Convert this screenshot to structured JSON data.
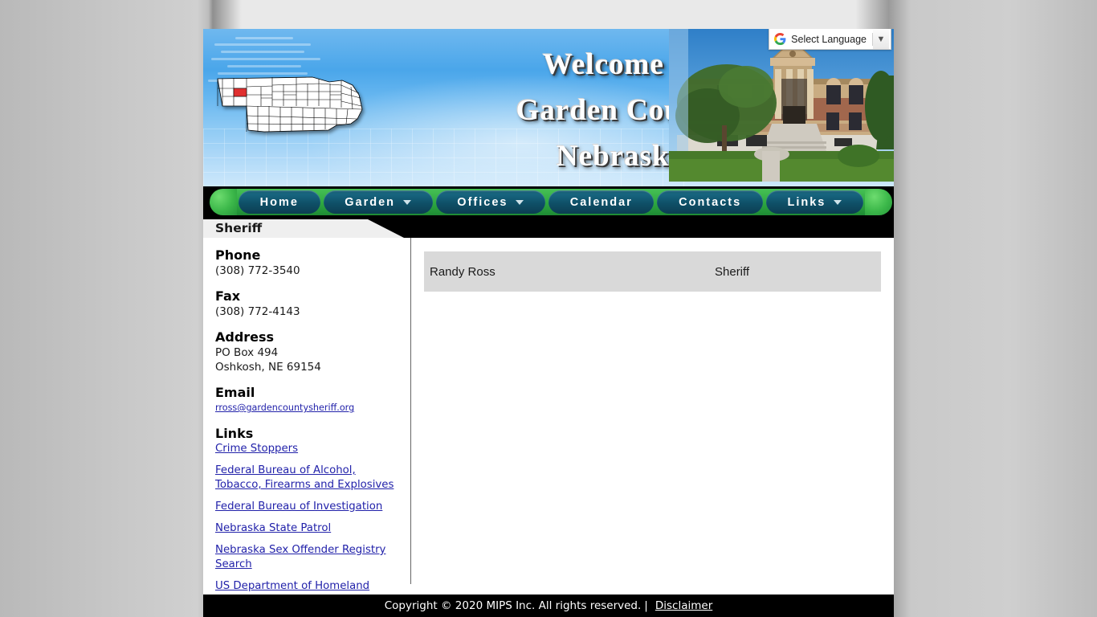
{
  "banner": {
    "line1": "Welcome to",
    "line2": "Garden County",
    "line3": "Nebraska",
    "map_alt": "nebraska-county-map",
    "photo_alt": "garden-county-courthouse-photo"
  },
  "translate": {
    "label": "Select Language",
    "arrow": "▼",
    "icon": "google-g-icon"
  },
  "nav": {
    "items": [
      {
        "label": "Home",
        "has_dropdown": false
      },
      {
        "label": "Garden",
        "has_dropdown": true
      },
      {
        "label": "Offices",
        "has_dropdown": true
      },
      {
        "label": "Calendar",
        "has_dropdown": false
      },
      {
        "label": "Contacts",
        "has_dropdown": false
      },
      {
        "label": "Links",
        "has_dropdown": true
      }
    ]
  },
  "page": {
    "title": "Sheriff"
  },
  "sidebar": {
    "phone_head": "Phone",
    "phone": "(308) 772-3540",
    "fax_head": "Fax",
    "fax": "(308) 772-4143",
    "address_head": "Address",
    "address_line1": "PO Box 494",
    "address_line2": "Oshkosh, NE 69154",
    "email_head": "Email",
    "email": "rross@gardencountysheriff.org",
    "links_head": "Links",
    "links": [
      "Crime Stoppers",
      "Federal Bureau of Alcohol, Tobacco, Firearms and Explosives",
      "Federal Bureau of Investigation",
      "Nebraska State Patrol",
      "Nebraska Sex Offender Registry Search",
      "US Department of Homeland Security"
    ]
  },
  "main": {
    "staff": [
      {
        "name": "Randy Ross",
        "title": "Sheriff"
      }
    ]
  },
  "footer": {
    "copyright": "Copyright © 2020 MIPS Inc.   All rights reserved.",
    "separator": "|",
    "disclaimer": "Disclaimer"
  },
  "colors": {
    "nav_green": "#2ea741",
    "nav_button": "#0f5068",
    "link_blue": "#2222aa",
    "row_gray": "#d9d9d9",
    "footer_bg": "#000000"
  }
}
